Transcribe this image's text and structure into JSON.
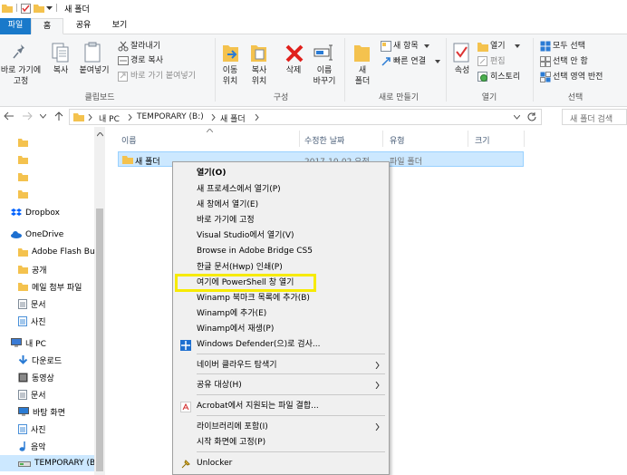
{
  "window": {
    "title": "새 폴더",
    "quick_sep": "|"
  },
  "tabs": {
    "file": "파일",
    "home": "홈",
    "share": "공유",
    "view": "보기"
  },
  "ribbon": {
    "clipboard": {
      "pin_label": "바로 가기에\n고정",
      "copy_label": "복사",
      "paste_label": "붙여넣기",
      "cut": "잘라내기",
      "copy_path": "경로 복사",
      "paste_shortcut": "바로 가기 붙여넣기",
      "group": "클립보드"
    },
    "organize": {
      "move_to": "이동\n위치",
      "copy_to": "복사\n위치",
      "delete": "삭제",
      "rename": "이름\n바꾸기",
      "group": "구성"
    },
    "new": {
      "new_folder": "새\n폴더",
      "new_item": "새 항목",
      "easy_access": "빠른 연결",
      "group": "새로 만들기"
    },
    "open": {
      "properties": "속성",
      "open": "열기",
      "edit": "편집",
      "history": "히스토리",
      "group": "열기"
    },
    "select": {
      "select_all": "모두 선택",
      "select_none": "선택 안 함",
      "invert": "선택 영역 반전",
      "group": "선택"
    }
  },
  "address": {
    "crumbs": [
      "내 PC",
      "TEMPORARY (B:)",
      "새 폴더"
    ],
    "search_placeholder": "새 폴더 검색"
  },
  "nav": {
    "items": [
      {
        "label": "",
        "icon": "folder-icon"
      },
      {
        "label": "",
        "icon": "folder-icon"
      },
      {
        "label": "",
        "icon": "folder-icon"
      },
      {
        "label": "",
        "icon": "folder-icon"
      },
      {
        "label": "Dropbox",
        "icon": "dropbox-icon"
      },
      {
        "label": "OneDrive",
        "icon": "onedrive-icon"
      },
      {
        "label": "Adobe Flash Bui",
        "icon": "folder-icon"
      },
      {
        "label": "공개",
        "icon": "folder-icon"
      },
      {
        "label": "메일 첨부 파일",
        "icon": "folder-icon"
      },
      {
        "label": "문서",
        "icon": "documents-icon"
      },
      {
        "label": "사진",
        "icon": "pictures-icon"
      },
      {
        "label": "내 PC",
        "icon": "pc-icon"
      },
      {
        "label": "다운로드",
        "icon": "downloads-icon"
      },
      {
        "label": "동영상",
        "icon": "videos-icon"
      },
      {
        "label": "문서",
        "icon": "documents-icon"
      },
      {
        "label": "바탕 화면",
        "icon": "desktop-icon"
      },
      {
        "label": "사진",
        "icon": "pictures-icon"
      },
      {
        "label": "음악",
        "icon": "music-icon"
      },
      {
        "label": "TEMPORARY (B:)",
        "icon": "drive-icon"
      }
    ]
  },
  "columns": {
    "name": "이름",
    "modified": "수정한 날짜",
    "type": "유형",
    "size": "크기"
  },
  "files": [
    {
      "name": "새 폴더",
      "modified": "2017-10-02 오전",
      "type": "파일 폴더"
    }
  ],
  "context_menu": {
    "items": [
      "열기(O)",
      "새 프로세스에서 열기(P)",
      "새 창에서 열기(E)",
      "바로 가기에 고정",
      "Visual Studio에서 열기(V)",
      "Browse in Adobe Bridge CS5",
      "한글 문서(Hwp) 인쇄(P)",
      "여기에 PowerShell 창 열기",
      "Winamp 북마크 목록에 추가(B)",
      "Winamp에 추가(E)",
      "Winamp에서 재생(P)",
      "Windows Defender(으)로 검사...",
      "네이버 클라우드 탐색기",
      "공유 대상(H)",
      "Acrobat에서 지원되는 파일 결합...",
      "라이브러리에 포함(I)",
      "시작 화면에 고정(P)",
      "Unlocker"
    ]
  },
  "colors": {
    "accent": "#1979ca",
    "selection": "#cce8ff",
    "highlight_box": "#f7ea00",
    "folder": "#f4c24e"
  }
}
